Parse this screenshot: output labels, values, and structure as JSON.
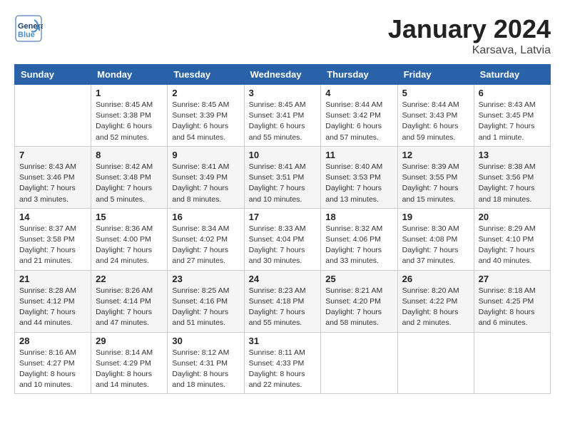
{
  "header": {
    "logo_line1": "General",
    "logo_line2": "Blue",
    "month": "January 2024",
    "location": "Karsava, Latvia"
  },
  "weekdays": [
    "Sunday",
    "Monday",
    "Tuesday",
    "Wednesday",
    "Thursday",
    "Friday",
    "Saturday"
  ],
  "weeks": [
    [
      {
        "day": "",
        "info": ""
      },
      {
        "day": "1",
        "info": "Sunrise: 8:45 AM\nSunset: 3:38 PM\nDaylight: 6 hours\nand 52 minutes."
      },
      {
        "day": "2",
        "info": "Sunrise: 8:45 AM\nSunset: 3:39 PM\nDaylight: 6 hours\nand 54 minutes."
      },
      {
        "day": "3",
        "info": "Sunrise: 8:45 AM\nSunset: 3:41 PM\nDaylight: 6 hours\nand 55 minutes."
      },
      {
        "day": "4",
        "info": "Sunrise: 8:44 AM\nSunset: 3:42 PM\nDaylight: 6 hours\nand 57 minutes."
      },
      {
        "day": "5",
        "info": "Sunrise: 8:44 AM\nSunset: 3:43 PM\nDaylight: 6 hours\nand 59 minutes."
      },
      {
        "day": "6",
        "info": "Sunrise: 8:43 AM\nSunset: 3:45 PM\nDaylight: 7 hours\nand 1 minute."
      }
    ],
    [
      {
        "day": "7",
        "info": "Sunrise: 8:43 AM\nSunset: 3:46 PM\nDaylight: 7 hours\nand 3 minutes."
      },
      {
        "day": "8",
        "info": "Sunrise: 8:42 AM\nSunset: 3:48 PM\nDaylight: 7 hours\nand 5 minutes."
      },
      {
        "day": "9",
        "info": "Sunrise: 8:41 AM\nSunset: 3:49 PM\nDaylight: 7 hours\nand 8 minutes."
      },
      {
        "day": "10",
        "info": "Sunrise: 8:41 AM\nSunset: 3:51 PM\nDaylight: 7 hours\nand 10 minutes."
      },
      {
        "day": "11",
        "info": "Sunrise: 8:40 AM\nSunset: 3:53 PM\nDaylight: 7 hours\nand 13 minutes."
      },
      {
        "day": "12",
        "info": "Sunrise: 8:39 AM\nSunset: 3:55 PM\nDaylight: 7 hours\nand 15 minutes."
      },
      {
        "day": "13",
        "info": "Sunrise: 8:38 AM\nSunset: 3:56 PM\nDaylight: 7 hours\nand 18 minutes."
      }
    ],
    [
      {
        "day": "14",
        "info": "Sunrise: 8:37 AM\nSunset: 3:58 PM\nDaylight: 7 hours\nand 21 minutes."
      },
      {
        "day": "15",
        "info": "Sunrise: 8:36 AM\nSunset: 4:00 PM\nDaylight: 7 hours\nand 24 minutes."
      },
      {
        "day": "16",
        "info": "Sunrise: 8:34 AM\nSunset: 4:02 PM\nDaylight: 7 hours\nand 27 minutes."
      },
      {
        "day": "17",
        "info": "Sunrise: 8:33 AM\nSunset: 4:04 PM\nDaylight: 7 hours\nand 30 minutes."
      },
      {
        "day": "18",
        "info": "Sunrise: 8:32 AM\nSunset: 4:06 PM\nDaylight: 7 hours\nand 33 minutes."
      },
      {
        "day": "19",
        "info": "Sunrise: 8:30 AM\nSunset: 4:08 PM\nDaylight: 7 hours\nand 37 minutes."
      },
      {
        "day": "20",
        "info": "Sunrise: 8:29 AM\nSunset: 4:10 PM\nDaylight: 7 hours\nand 40 minutes."
      }
    ],
    [
      {
        "day": "21",
        "info": "Sunrise: 8:28 AM\nSunset: 4:12 PM\nDaylight: 7 hours\nand 44 minutes."
      },
      {
        "day": "22",
        "info": "Sunrise: 8:26 AM\nSunset: 4:14 PM\nDaylight: 7 hours\nand 47 minutes."
      },
      {
        "day": "23",
        "info": "Sunrise: 8:25 AM\nSunset: 4:16 PM\nDaylight: 7 hours\nand 51 minutes."
      },
      {
        "day": "24",
        "info": "Sunrise: 8:23 AM\nSunset: 4:18 PM\nDaylight: 7 hours\nand 55 minutes."
      },
      {
        "day": "25",
        "info": "Sunrise: 8:21 AM\nSunset: 4:20 PM\nDaylight: 7 hours\nand 58 minutes."
      },
      {
        "day": "26",
        "info": "Sunrise: 8:20 AM\nSunset: 4:22 PM\nDaylight: 8 hours\nand 2 minutes."
      },
      {
        "day": "27",
        "info": "Sunrise: 8:18 AM\nSunset: 4:25 PM\nDaylight: 8 hours\nand 6 minutes."
      }
    ],
    [
      {
        "day": "28",
        "info": "Sunrise: 8:16 AM\nSunset: 4:27 PM\nDaylight: 8 hours\nand 10 minutes."
      },
      {
        "day": "29",
        "info": "Sunrise: 8:14 AM\nSunset: 4:29 PM\nDaylight: 8 hours\nand 14 minutes."
      },
      {
        "day": "30",
        "info": "Sunrise: 8:12 AM\nSunset: 4:31 PM\nDaylight: 8 hours\nand 18 minutes."
      },
      {
        "day": "31",
        "info": "Sunrise: 8:11 AM\nSunset: 4:33 PM\nDaylight: 8 hours\nand 22 minutes."
      },
      {
        "day": "",
        "info": ""
      },
      {
        "day": "",
        "info": ""
      },
      {
        "day": "",
        "info": ""
      }
    ]
  ]
}
